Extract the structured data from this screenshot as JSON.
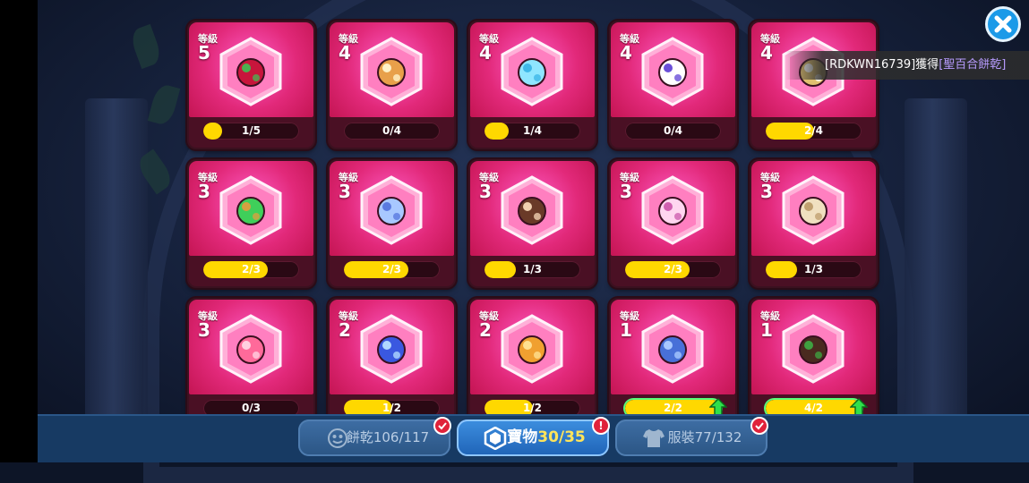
{
  "level_label": "等級",
  "treasures": [
    {
      "name": "berry-treasure",
      "level": "5",
      "progress": "1/5",
      "fill": 0.2,
      "icon": "red-berry-icon",
      "full": false
    },
    {
      "name": "scroll-treasure",
      "level": "4",
      "progress": "0/4",
      "fill": 0,
      "icon": "scroll-icon",
      "full": false
    },
    {
      "name": "coral-treasure",
      "level": "4",
      "progress": "1/4",
      "fill": 0.25,
      "icon": "coral-icon",
      "full": false
    },
    {
      "name": "unicorn-treasure",
      "level": "4",
      "progress": "0/4",
      "fill": 0,
      "icon": "unicorn-icon",
      "full": false
    },
    {
      "name": "wreath-treasure",
      "level": "4",
      "progress": "2/4",
      "fill": 0.5,
      "icon": "wreath-icon",
      "full": false
    },
    {
      "name": "potion-treasure",
      "level": "3",
      "progress": "2/3",
      "fill": 0.67,
      "icon": "potion-icon",
      "full": false
    },
    {
      "name": "clock-treasure",
      "level": "3",
      "progress": "2/3",
      "fill": 0.67,
      "icon": "clock-icon",
      "full": false
    },
    {
      "name": "shell-treasure",
      "level": "3",
      "progress": "1/3",
      "fill": 0.33,
      "icon": "shell-icon",
      "full": false
    },
    {
      "name": "flower-treasure",
      "level": "3",
      "progress": "2/3",
      "fill": 0.67,
      "icon": "flower-icon",
      "full": false
    },
    {
      "name": "mummy-treasure",
      "level": "3",
      "progress": "1/3",
      "fill": 0.33,
      "icon": "mummy-icon",
      "full": false
    },
    {
      "name": "flamingo-treasure",
      "level": "3",
      "progress": "0/3",
      "fill": 0,
      "icon": "flamingo-icon",
      "full": false
    },
    {
      "name": "crystal-treasure",
      "level": "2",
      "progress": "1/2",
      "fill": 0.5,
      "icon": "crystal-icon",
      "full": false
    },
    {
      "name": "mushroom-treasure",
      "level": "2",
      "progress": "1/2",
      "fill": 0.5,
      "icon": "mushroom-icon",
      "full": false
    },
    {
      "name": "dragon-treasure",
      "level": "1",
      "progress": "2/2",
      "fill": 1,
      "icon": "dragon-icon",
      "full": true
    },
    {
      "name": "pie-treasure",
      "level": "1",
      "progress": "4/2",
      "fill": 1,
      "icon": "pie-icon",
      "full": true
    }
  ],
  "toast": {
    "prefix": "[RDKWN16739]獲得",
    "highlight": "[聖百合餅乾]"
  },
  "tabs": [
    {
      "label": "餅乾",
      "count": "106/117",
      "icon": "cookie-face-icon"
    },
    {
      "label": "寶物",
      "count": "30/35",
      "icon": "treasure-hex-icon"
    },
    {
      "label": "服裝",
      "count": "77/132",
      "icon": "shirt-icon"
    }
  ],
  "badges": {
    "cookies": "check",
    "treasures": "!",
    "costumes": "check"
  },
  "colors": {
    "card": "#e2297a",
    "bar_fill": "#ffd800",
    "active_tab": "#2f7fd4",
    "accent_count": "#ffe45a",
    "badge": "#e0223a",
    "upgrade": "#2fe04a",
    "close": "#1b9ae8"
  }
}
